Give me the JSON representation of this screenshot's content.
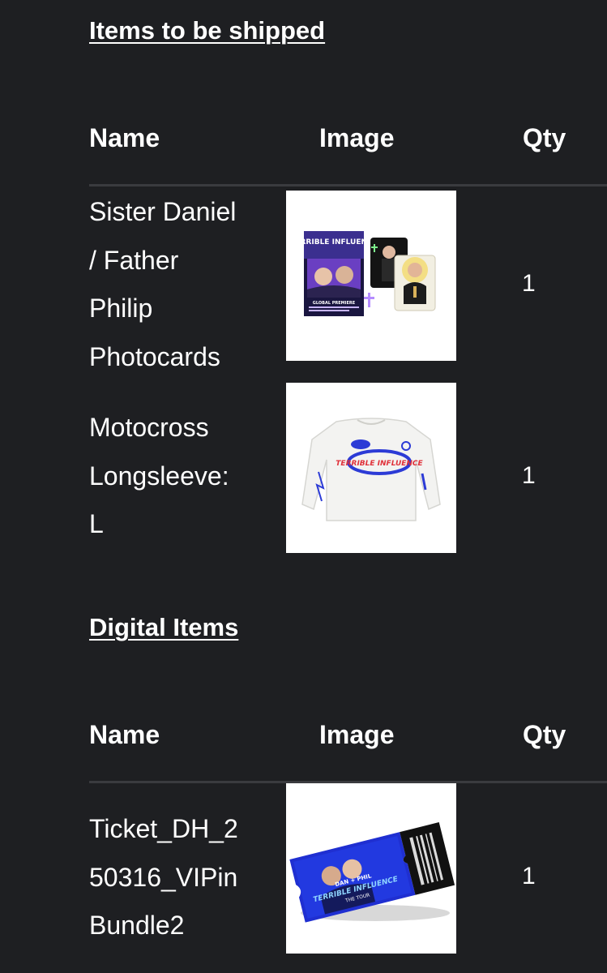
{
  "shipped": {
    "title": "Items to be shipped",
    "headers": {
      "name": "Name",
      "image": "Image",
      "qty": "Qty"
    },
    "items": [
      {
        "name_lines": [
          "Sister Daniel",
          "/ Father",
          "Philip",
          "Photocards"
        ],
        "image": "photocards-product-image",
        "qty": "1"
      },
      {
        "name_lines": [
          "Motocross",
          "Longsleeve:",
          "L"
        ],
        "image": "longsleeve-product-image",
        "qty": "1"
      }
    ]
  },
  "digital": {
    "title": "Digital Items",
    "headers": {
      "name": "Name",
      "image": "Image",
      "qty": "Qty"
    },
    "items": [
      {
        "name_lines": [
          "Ticket_DH_2",
          "50316_VIPin",
          "Bundle2"
        ],
        "image": "ticket-product-image",
        "qty": "1"
      }
    ]
  },
  "artwork_text": {
    "poster_title": "TERRIBLE INFLUENCE",
    "poster_subtitle": "GLOBAL PREMIERE",
    "shirt_text": "TERRIBLE INFLUENCE",
    "ticket_line1": "DAN + PHIL",
    "ticket_line2": "TERRIBLE INFLUENCE",
    "ticket_line3": "THE TOUR"
  },
  "colors": {
    "background": "#1e1f22",
    "text": "#ffffff",
    "divider": "#3a3b3f"
  }
}
